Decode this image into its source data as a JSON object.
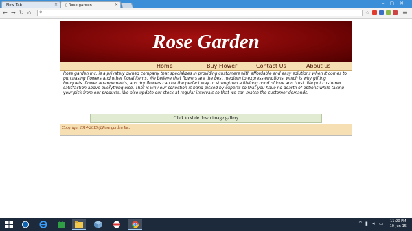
{
  "browser": {
    "tabs": [
      {
        "title": "New Tab"
      },
      {
        "title": "Rose garden"
      }
    ],
    "address": ""
  },
  "site": {
    "title": "Rose Garden",
    "nav": [
      "Home",
      "Buy Flower",
      "Contact Us",
      "About us"
    ],
    "intro": "Rose garden Inc. is a privately owned company that specializes in providing customers with affordable and easy solutions when it comes to purchasing flowers and other floral items. We believe that flowers are the best medium to express emotions, which is why gifting bouquets, flower arrangements, and dry flowers can be the perfect way to strengthen a lifelong bond of love and trust. We put customer satisfaction above everything else. That is why our collection is hand picked by experts so that you have no dearth of options while taking your pick from our products. We also update our stock at regular intervals so that we can match the customer demands.",
    "gallery_button": "Click to slide down image gallery",
    "footer": "Copyright 2014-2015 @Rose garden Inc."
  },
  "taskbar": {
    "time": "11:20 PM",
    "date": "10-Jun-15"
  },
  "colors": {
    "banner": "#7a0606",
    "nav_bg": "#f6dfb3",
    "gallery_btn": "#e1ebd2",
    "taskbar": "#1c2a3c"
  }
}
